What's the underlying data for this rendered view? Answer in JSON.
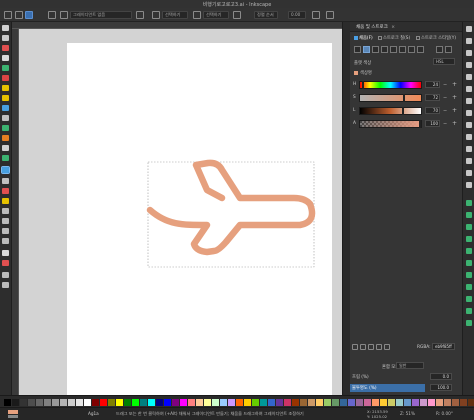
{
  "window": {
    "title": "비행기로고로고3.ai - Inkscape"
  },
  "toolbar": {
    "selection_field": "그레이디언트 없음",
    "field_b": "선택하기",
    "field_c": "선택하기",
    "field_d": "정렬 순서",
    "opacity_field": "0.00"
  },
  "panel": {
    "tab_title": "채움 및 스트로크",
    "subtabs": [
      {
        "label": "채움(F)",
        "active": true
      },
      {
        "label": "스트로크 칠(S)",
        "active": false
      },
      {
        "label": "스트로크 스타일(Y)",
        "active": false
      }
    ],
    "mode_label": "플랫 색상",
    "mode_value": "HSL",
    "color_name": "색상명",
    "sliders": [
      {
        "label": "H",
        "value": "24",
        "knob_pct": 0.07
      },
      {
        "label": "S",
        "value": "72",
        "knob_pct": 0.72
      },
      {
        "label": "L",
        "value": "70",
        "knob_pct": 0.7
      },
      {
        "label": "A",
        "value": "100",
        "knob_pct": 1.0
      }
    ],
    "rgba_label": "RGBA:",
    "rgba_value": "eb9f85ff",
    "blend_label": "혼합 모드:",
    "blend_value": "일반",
    "blur_label": "흐림 (%)",
    "blur_value": "0.0",
    "opacity_label": "불투명도 (%)",
    "opacity_value": "100.0",
    "opacity_fraction": 0.75
  },
  "status": {
    "layer": "Ag1a",
    "message": "드래그 또는 한 번 클릭하여 (+Alt) 채워서 그레이디언트 만들기; 채움을 드래그하여 그레이디언트 조정하기",
    "x_label": "X:",
    "x_value": "2153.59",
    "y_label": "Y:",
    "y_value": "1025.02",
    "zoom": "Z: 51%",
    "rotation": "R: 0.00°"
  },
  "colors": {
    "fill": "#eb9f85",
    "accent": "#3b6fa8"
  },
  "palette": [
    "#000000",
    "#1a1a1a",
    "#333333",
    "#4d4d4d",
    "#666666",
    "#808080",
    "#999999",
    "#b3b3b3",
    "#cccccc",
    "#e6e6e6",
    "#ffffff",
    "#800000",
    "#ff0000",
    "#808000",
    "#ffff00",
    "#008000",
    "#00ff00",
    "#008080",
    "#00ffff",
    "#000080",
    "#0000ff",
    "#800080",
    "#ff00ff",
    "#ff8080",
    "#ffcc99",
    "#ffff99",
    "#ccffcc",
    "#99ccff",
    "#cc99ff",
    "#ff6600",
    "#ffcc00",
    "#66cc00",
    "#009999",
    "#3366cc",
    "#663399",
    "#cc3366",
    "#993300",
    "#996633",
    "#cc9966",
    "#ffcc66",
    "#99cc66",
    "#669966",
    "#336699",
    "#6666cc",
    "#996699",
    "#cc6699",
    "#ff9966",
    "#ffcc33",
    "#cccc66",
    "#99cccc",
    "#6699cc",
    "#9966cc",
    "#cc99cc",
    "#ff99cc",
    "#e6a07e",
    "#c08060",
    "#a06040",
    "#804020",
    "#603010"
  ]
}
